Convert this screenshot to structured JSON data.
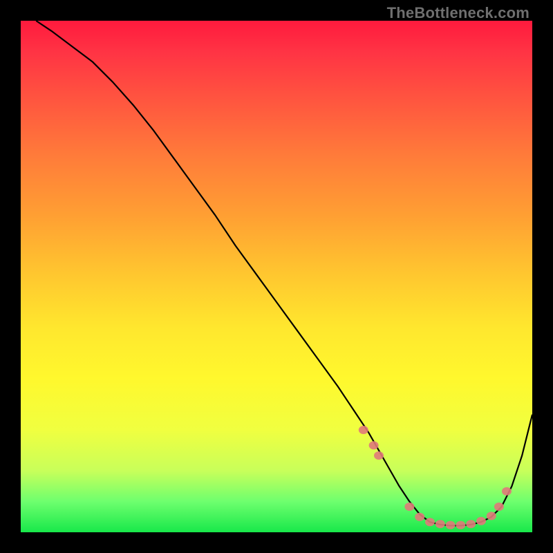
{
  "watermark": "TheBottleneck.com",
  "colors": {
    "frame": "#000000",
    "marker": "#e07a7a",
    "curve": "#000000"
  },
  "chart_data": {
    "type": "line",
    "title": "",
    "xlabel": "",
    "ylabel": "",
    "xlim": [
      0,
      100
    ],
    "ylim": [
      0,
      100
    ],
    "grid": false,
    "legend": false,
    "series": [
      {
        "name": "curve",
        "x": [
          3,
          6,
          10,
          14,
          18,
          22,
          26,
          30,
          34,
          38,
          42,
          46,
          50,
          54,
          58,
          62,
          64,
          66,
          68,
          70,
          72,
          74,
          76,
          78,
          80,
          82,
          84,
          86,
          88,
          90,
          92,
          94,
          96,
          98,
          100
        ],
        "y": [
          100,
          98,
          95,
          92,
          88,
          83.5,
          78.5,
          73,
          67.5,
          62,
          56,
          50.5,
          45,
          39.5,
          34,
          28.5,
          25.5,
          22.5,
          19.5,
          16,
          12.5,
          9,
          6,
          3.5,
          2,
          1.5,
          1.3,
          1.3,
          1.5,
          2,
          3,
          5,
          9,
          15,
          23
        ]
      }
    ],
    "markers": [
      {
        "x": 67,
        "y": 20
      },
      {
        "x": 69,
        "y": 17
      },
      {
        "x": 70,
        "y": 15
      },
      {
        "x": 76,
        "y": 5
      },
      {
        "x": 78,
        "y": 3
      },
      {
        "x": 80,
        "y": 2
      },
      {
        "x": 82,
        "y": 1.6
      },
      {
        "x": 84,
        "y": 1.4
      },
      {
        "x": 86,
        "y": 1.4
      },
      {
        "x": 88,
        "y": 1.6
      },
      {
        "x": 90,
        "y": 2.2
      },
      {
        "x": 92,
        "y": 3.2
      },
      {
        "x": 93.5,
        "y": 5
      },
      {
        "x": 95,
        "y": 8
      }
    ]
  }
}
